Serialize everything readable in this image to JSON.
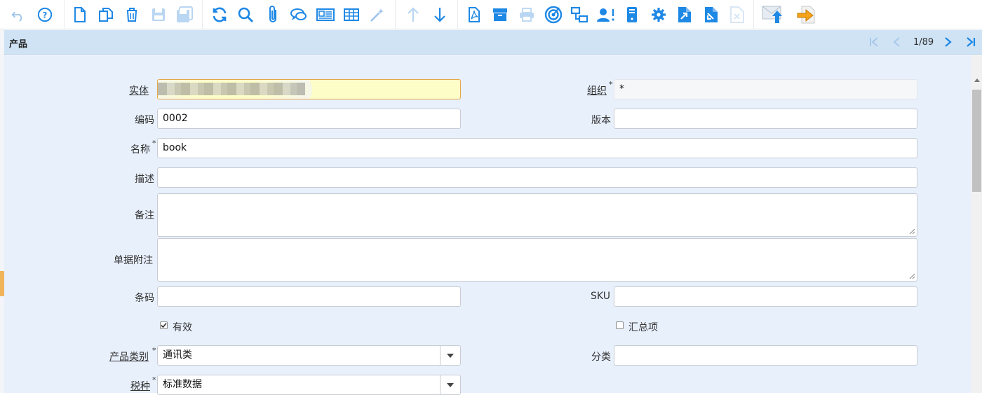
{
  "window": {
    "title": "产品"
  },
  "colors": {
    "accent": "#1e88e5",
    "titlebar": "#cfe3f5",
    "form_bg": "#e8f0fc",
    "highlight": "#fdfdc8"
  },
  "toolbar": {
    "icons": [
      "undo-icon",
      "help-icon",
      "new-record-icon",
      "copy-record-icon",
      "delete-icon",
      "save-icon",
      "save-new-icon",
      "refresh-icon",
      "search-icon",
      "attachment-icon",
      "chat-icon",
      "card-view-icon",
      "grid-view-icon",
      "wizard-icon",
      "previous-record-icon",
      "next-record-icon",
      "pdf-icon",
      "archive-icon",
      "print-icon",
      "zoom-across-icon",
      "related-icon",
      "request-icon",
      "product-info-icon",
      "settings-icon",
      "export-icon",
      "import-icon",
      "close-doc-icon",
      "upload-icon",
      "exit-icon"
    ]
  },
  "pager": {
    "current": "1/89"
  },
  "form": {
    "entity": {
      "label": "实体",
      "value": ""
    },
    "org": {
      "label": "组织",
      "value": "*"
    },
    "code": {
      "label": "编码",
      "value": "0002"
    },
    "version": {
      "label": "版本",
      "value": ""
    },
    "name": {
      "label": "名称",
      "value": "book"
    },
    "description": {
      "label": "描述",
      "value": ""
    },
    "remark": {
      "label": "备注",
      "value": ""
    },
    "doc_note": {
      "label": "单据附注",
      "value": ""
    },
    "barcode": {
      "label": "条码",
      "value": ""
    },
    "sku": {
      "label": "SKU",
      "value": ""
    },
    "active": {
      "label": "有效",
      "checked": true
    },
    "summary": {
      "label": "汇总项",
      "checked": false
    },
    "category": {
      "label": "产品类别",
      "value": "通讯类"
    },
    "classification": {
      "label": "分类",
      "value": ""
    },
    "tax": {
      "label": "税种",
      "value": "标准数据"
    },
    "required_mark": "*"
  }
}
